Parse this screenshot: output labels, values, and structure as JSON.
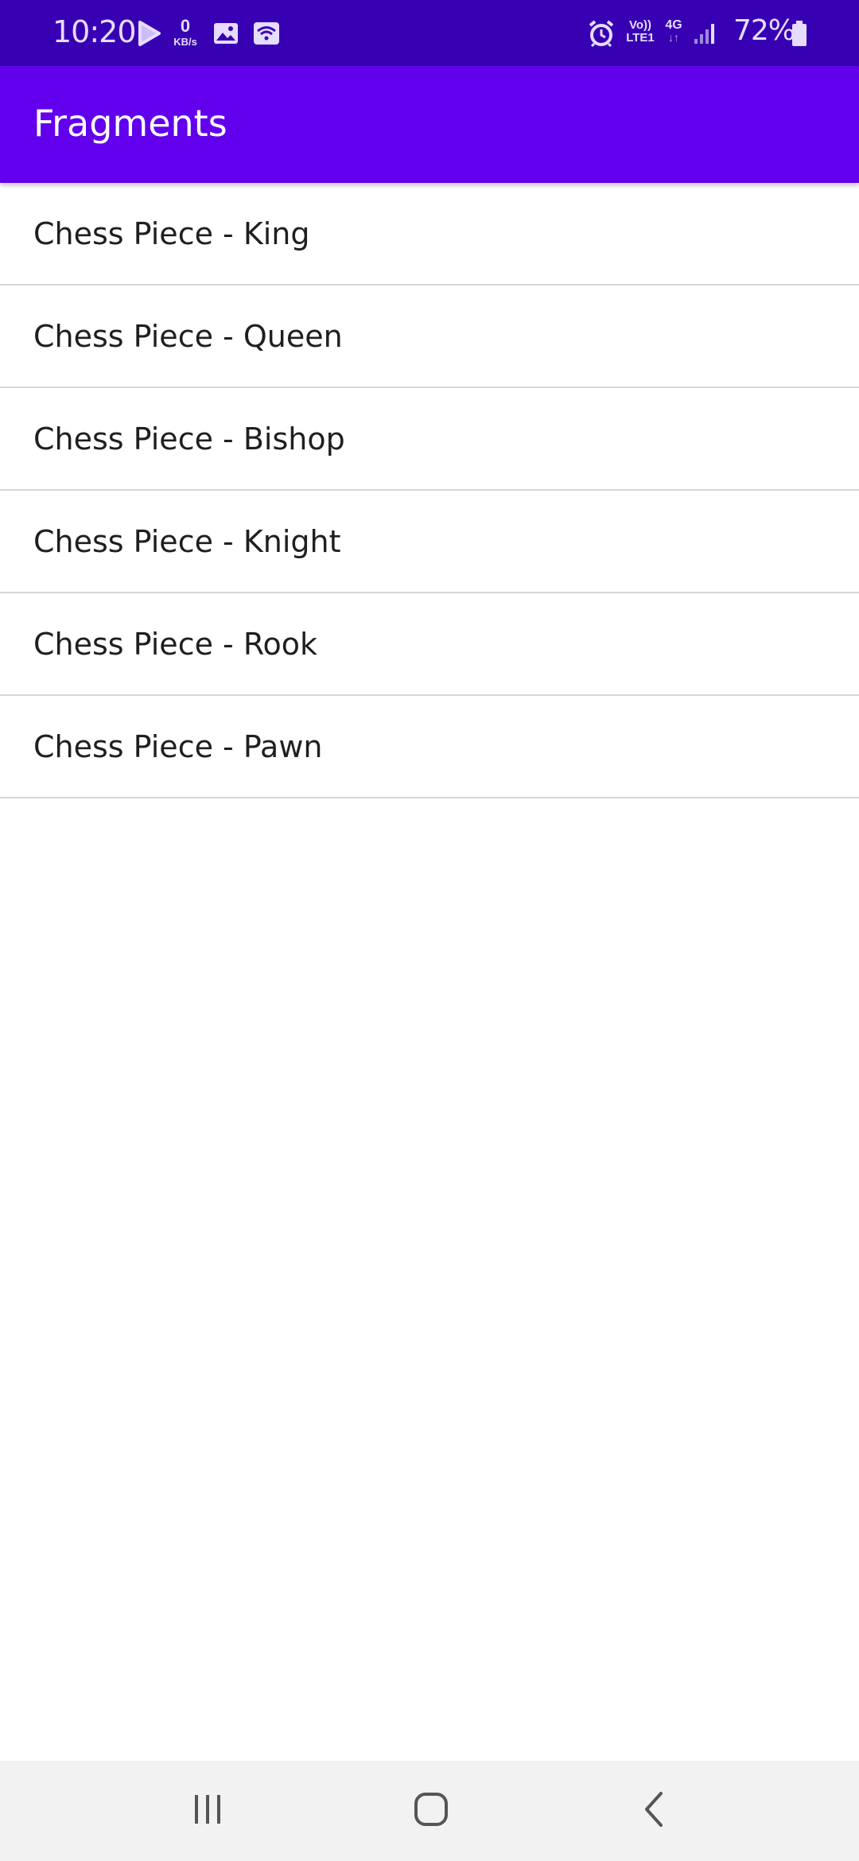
{
  "status_bar": {
    "time": "10:20",
    "data_speed_value": "0",
    "data_speed_unit": "KB/s",
    "volte_line1": "Vo))",
    "volte_line2": "LTE1",
    "network_type": "4G",
    "network_arrows": "↓↑",
    "battery_percent": "72%",
    "icons": [
      "play-store-icon",
      "gallery-icon",
      "wifi-icon",
      "alarm-icon",
      "signal-icon",
      "battery-icon"
    ]
  },
  "app_bar": {
    "title": "Fragments"
  },
  "list": {
    "items": [
      {
        "label": "Chess Piece - King"
      },
      {
        "label": "Chess Piece - Queen"
      },
      {
        "label": "Chess Piece - Bishop"
      },
      {
        "label": "Chess Piece - Knight"
      },
      {
        "label": "Chess Piece - Rook"
      },
      {
        "label": "Chess Piece - Pawn"
      }
    ]
  },
  "nav_bar": {
    "icons": [
      "recent-apps-icon",
      "home-icon",
      "back-icon"
    ]
  },
  "colors": {
    "status_bar": "#3700b3",
    "app_bar": "#6200ee",
    "divider": "#d6d6d6",
    "nav_bar": "#f2f2f2"
  }
}
